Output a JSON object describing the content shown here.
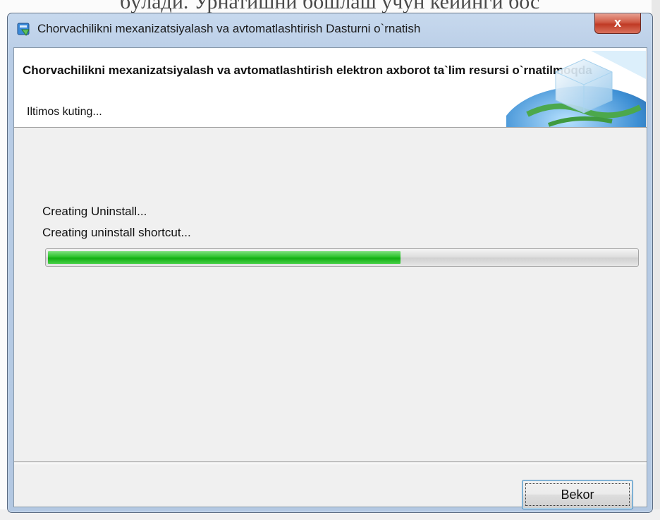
{
  "window": {
    "title": "Chorvachilikni mexanizatsiyalash va avtomatlashtirish Dasturni o`rnatish",
    "close_label": "x"
  },
  "header": {
    "title": "Chorvachilikni mexanizatsiyalash va avtomatlashtirish elektron axborot ta`lim resursi o`rnatilmoqda",
    "subtitle": "Iltimos kuting..."
  },
  "status": {
    "line1": "Creating Uninstall...",
    "line2": "Creating uninstall shortcut..."
  },
  "progress": {
    "fraction": 0.6,
    "color": "#22bb22"
  },
  "buttons": {
    "cancel_label": "Bekor"
  },
  "background": {
    "top_text": "бўлади. Урнатишни бошлаш учун кейинги бос"
  },
  "icons": {
    "app": "installer-icon",
    "header": "globe-cube-icon",
    "close": "close-icon"
  }
}
